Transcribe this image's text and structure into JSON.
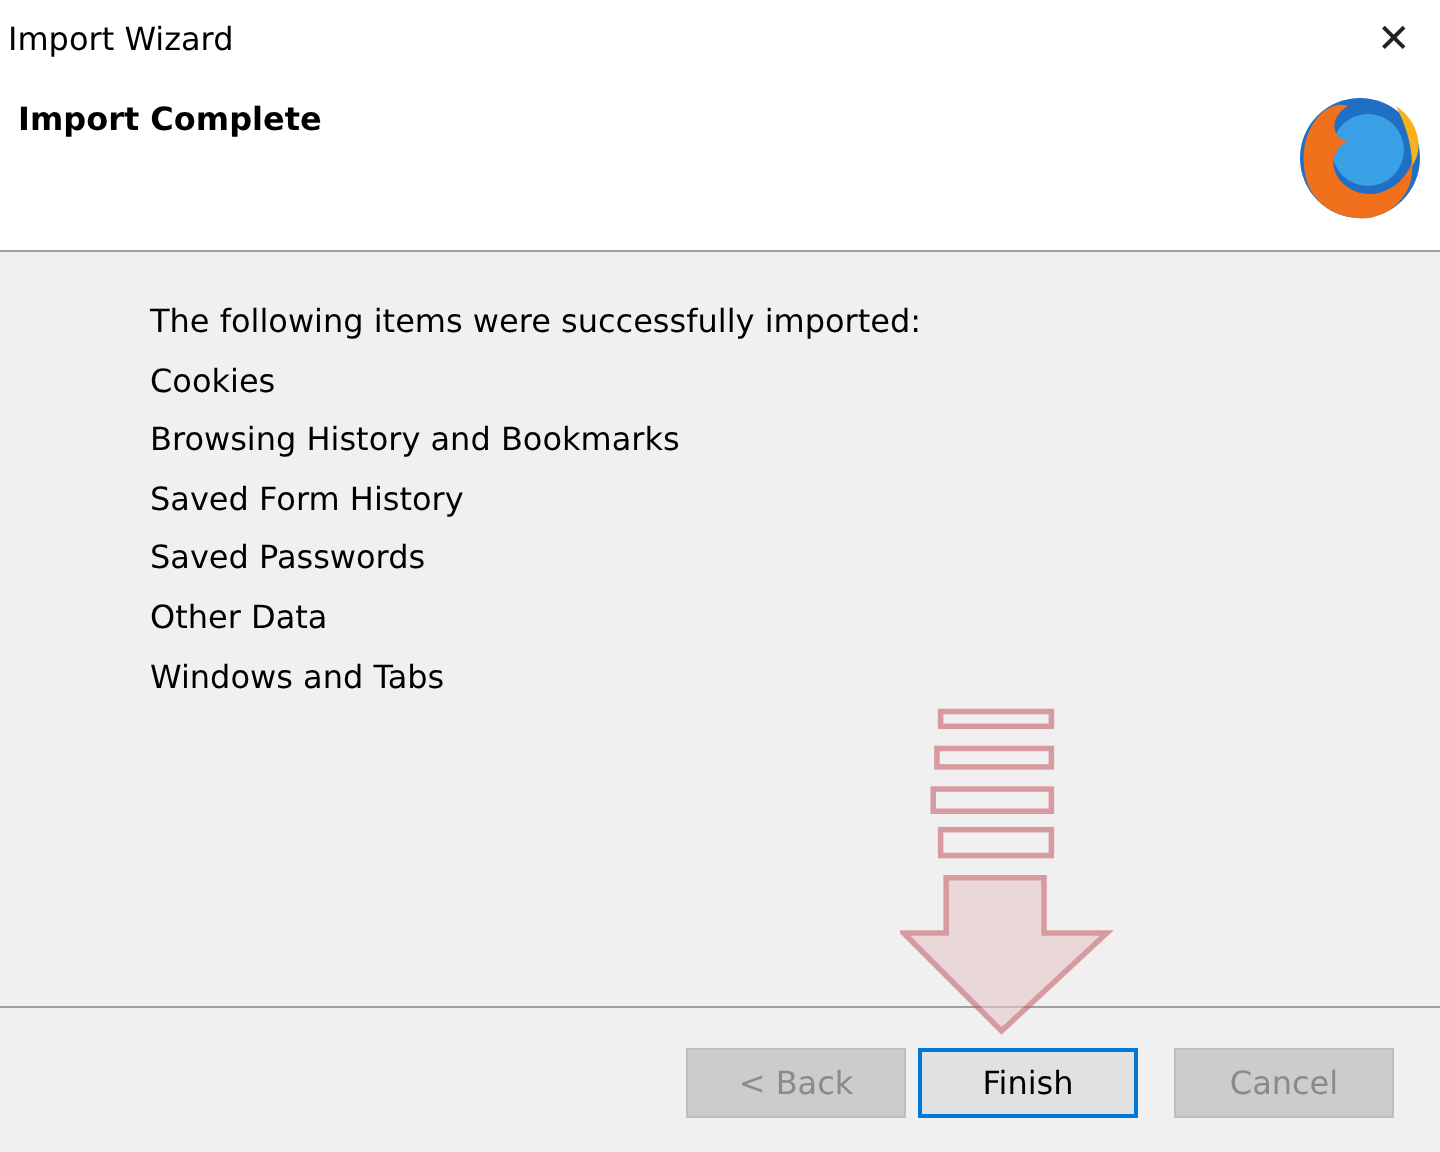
{
  "window": {
    "title": "Import Wizard",
    "close": "✕"
  },
  "header": {
    "title": "Import Complete"
  },
  "message": "The following items were successfully imported:",
  "items": [
    "Cookies",
    "Browsing History and Bookmarks",
    "Saved Form History",
    "Saved Passwords",
    "Other Data",
    "Windows and Tabs"
  ],
  "buttons": [
    {
      "label": "< Back",
      "disabled": true,
      "focused": false
    },
    {
      "label": "Finish",
      "disabled": false,
      "focused": true
    },
    {
      "label": "Cancel",
      "disabled": true,
      "focused": false
    }
  ]
}
